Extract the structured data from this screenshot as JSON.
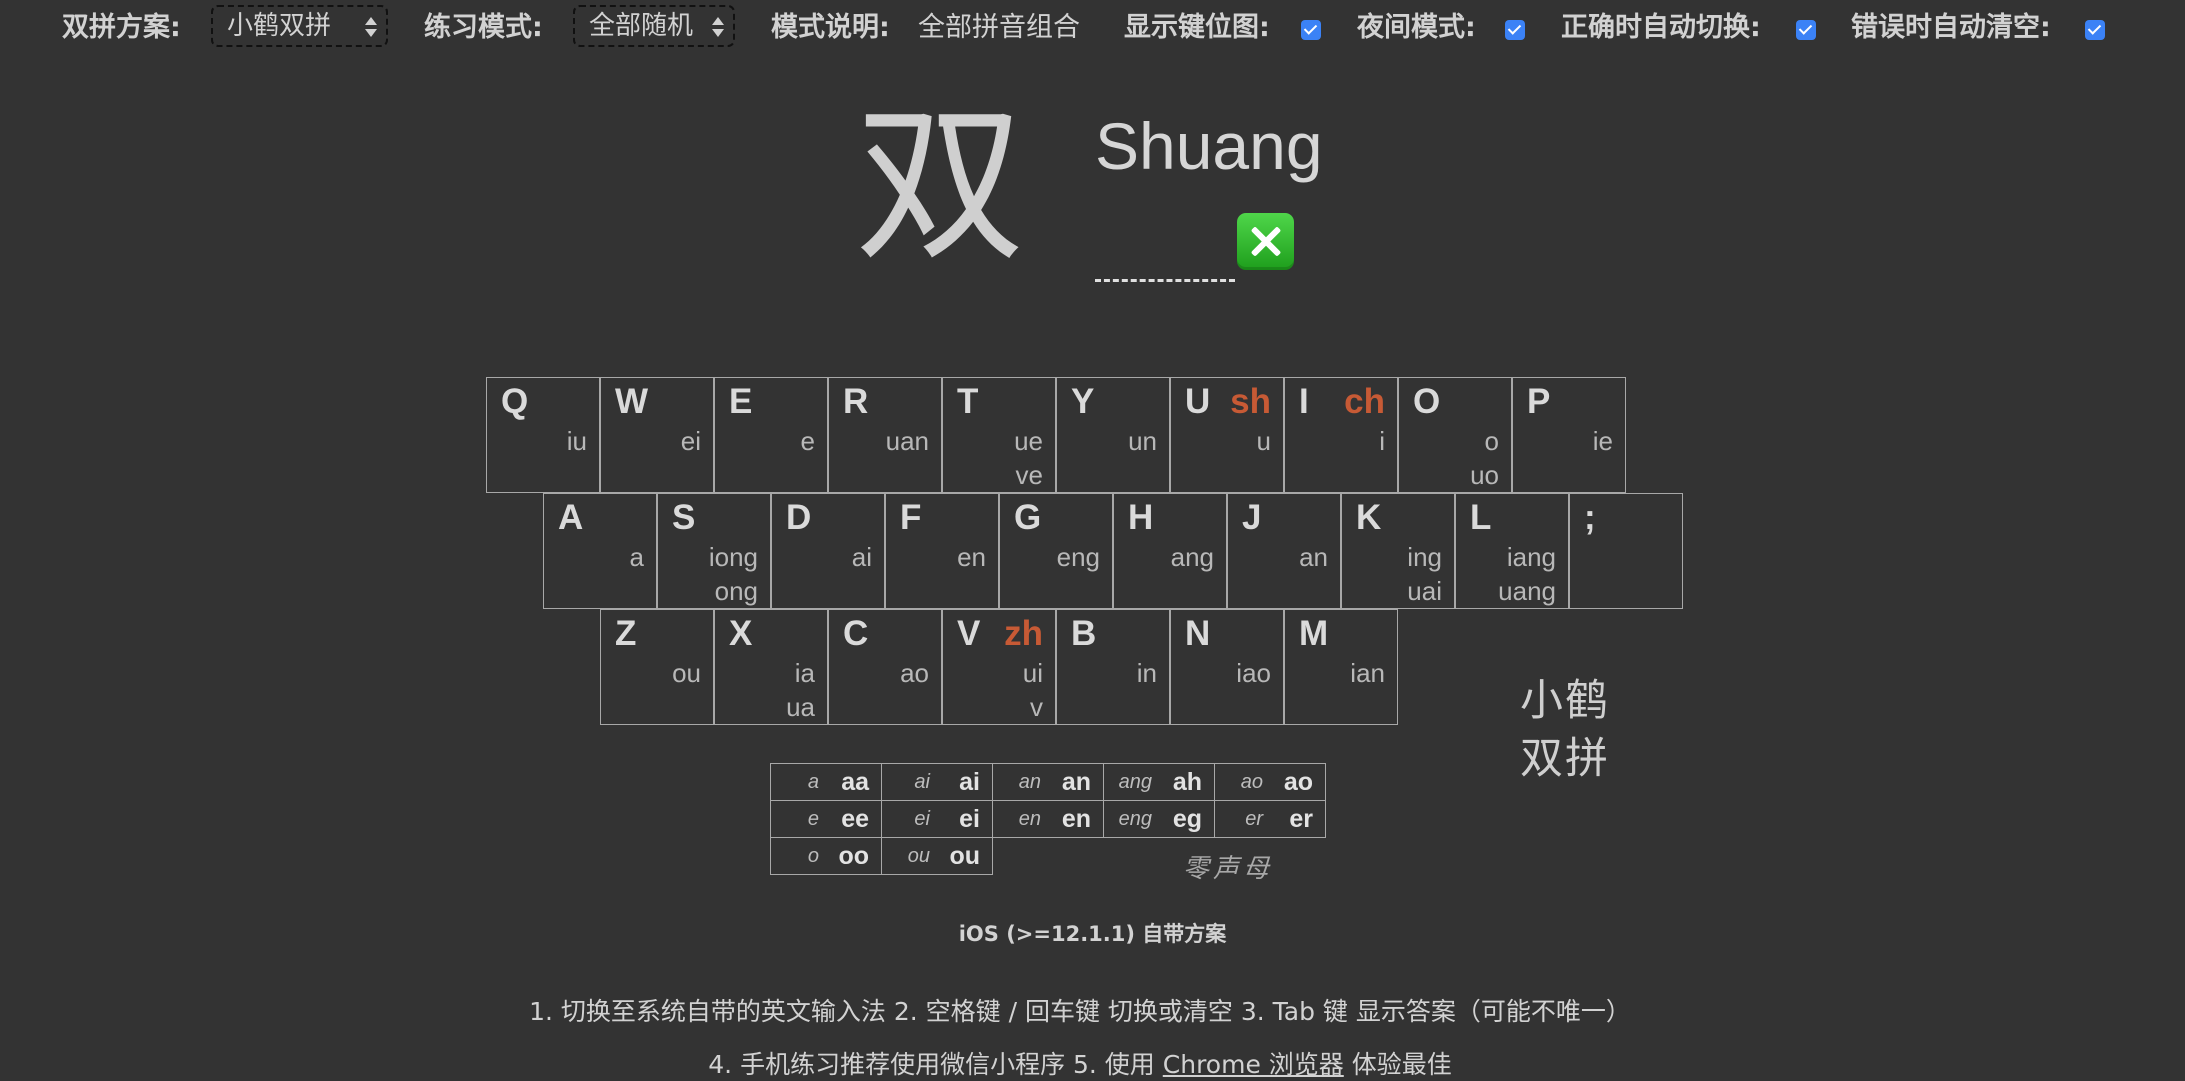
{
  "topbar": {
    "scheme_label": "双拼方案:",
    "scheme_value": "小鹤双拼",
    "mode_label": "练习模式:",
    "mode_value": "全部随机",
    "desc_label": "模式说明:",
    "desc_value": "全部拼音组合",
    "show_keymap_label": "显示键位图:",
    "night_mode_label": "夜间模式:",
    "auto_switch_label": "正确时自动切换:",
    "auto_clear_label": "错误时自动清空:",
    "show_keymap_checked": true,
    "night_mode_checked": true,
    "auto_switch_checked": true,
    "auto_clear_checked": true,
    "checkbox_color": "#3b82f6"
  },
  "practice": {
    "hanzi": "双",
    "pinyin": "Shuang",
    "answer_value": "",
    "result_icon": "cross-mark-icon",
    "result_color": "#2eb82b"
  },
  "keyboard": {
    "accent_color": "#c75a35",
    "rows": [
      [
        {
          "key": "Q",
          "consonant": "",
          "vowels": "iu"
        },
        {
          "key": "W",
          "consonant": "",
          "vowels": "ei"
        },
        {
          "key": "E",
          "consonant": "",
          "vowels": "e"
        },
        {
          "key": "R",
          "consonant": "",
          "vowels": "uan"
        },
        {
          "key": "T",
          "consonant": "",
          "vowels": "ue\nve"
        },
        {
          "key": "Y",
          "consonant": "",
          "vowels": "un"
        },
        {
          "key": "U",
          "consonant": "sh",
          "vowels": "u"
        },
        {
          "key": "I",
          "consonant": "ch",
          "vowels": "i"
        },
        {
          "key": "O",
          "consonant": "",
          "vowels": "o\nuo"
        },
        {
          "key": "P",
          "consonant": "",
          "vowels": "ie"
        }
      ],
      [
        {
          "key": "A",
          "consonant": "",
          "vowels": "a"
        },
        {
          "key": "S",
          "consonant": "",
          "vowels": "iong\nong"
        },
        {
          "key": "D",
          "consonant": "",
          "vowels": "ai"
        },
        {
          "key": "F",
          "consonant": "",
          "vowels": "en"
        },
        {
          "key": "G",
          "consonant": "",
          "vowels": "eng"
        },
        {
          "key": "H",
          "consonant": "",
          "vowels": "ang"
        },
        {
          "key": "J",
          "consonant": "",
          "vowels": "an"
        },
        {
          "key": "K",
          "consonant": "",
          "vowels": "ing\nuai"
        },
        {
          "key": "L",
          "consonant": "",
          "vowels": "iang\nuang"
        },
        {
          "key": ";",
          "consonant": "",
          "vowels": ""
        }
      ],
      [
        {
          "key": "Z",
          "consonant": "",
          "vowels": "ou"
        },
        {
          "key": "X",
          "consonant": "",
          "vowels": "ia\nua"
        },
        {
          "key": "C",
          "consonant": "",
          "vowels": "ao"
        },
        {
          "key": "V",
          "consonant": "zh",
          "vowels": "ui\nv"
        },
        {
          "key": "B",
          "consonant": "",
          "vowels": "in"
        },
        {
          "key": "N",
          "consonant": "",
          "vowels": "iao"
        },
        {
          "key": "M",
          "consonant": "",
          "vowels": "ian"
        }
      ]
    ],
    "logo_text": "小鹤 双拼"
  },
  "zero_initials": {
    "rows": [
      [
        [
          "a",
          "aa"
        ],
        [
          "ai",
          "ai"
        ],
        [
          "an",
          "an"
        ],
        [
          "ang",
          "ah"
        ],
        [
          "ao",
          "ao"
        ]
      ],
      [
        [
          "e",
          "ee"
        ],
        [
          "ei",
          "ei"
        ],
        [
          "en",
          "en"
        ],
        [
          "eng",
          "eg"
        ],
        [
          "er",
          "er"
        ]
      ],
      [
        [
          "o",
          "oo"
        ],
        [
          "ou",
          "ou"
        ]
      ]
    ],
    "label": "零声母"
  },
  "footer": {
    "scheme_note": "iOS (>=12.1.1) 自带方案",
    "help_line1": "1. 切换至系统自带的英文输入法   2. 空格键 / 回车键 切换或清空   3. Tab 键 显示答案（可能不唯一）",
    "help_line2_prefix": "4. 手机练习推荐使用微信小程序   5. 使用 ",
    "help_link": "Chrome 浏览器",
    "help_line2_suffix": " 体验最佳"
  }
}
